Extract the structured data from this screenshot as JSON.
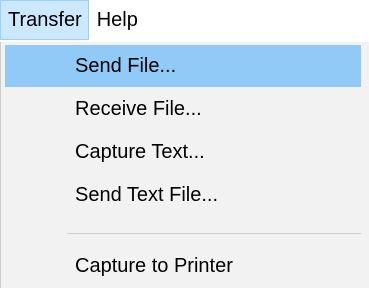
{
  "menubar": {
    "items": [
      {
        "label": "Transfer"
      },
      {
        "label": "Help"
      }
    ]
  },
  "transfer_menu": {
    "items": [
      {
        "label": "Send File..."
      },
      {
        "label": "Receive File..."
      },
      {
        "label": "Capture Text..."
      },
      {
        "label": "Send Text File..."
      },
      {
        "label": "Capture to Printer"
      }
    ],
    "highlight_color": "#91c9f7",
    "menu_background": "#f2f2f2",
    "active_menubar_color": "#cce8ff"
  }
}
